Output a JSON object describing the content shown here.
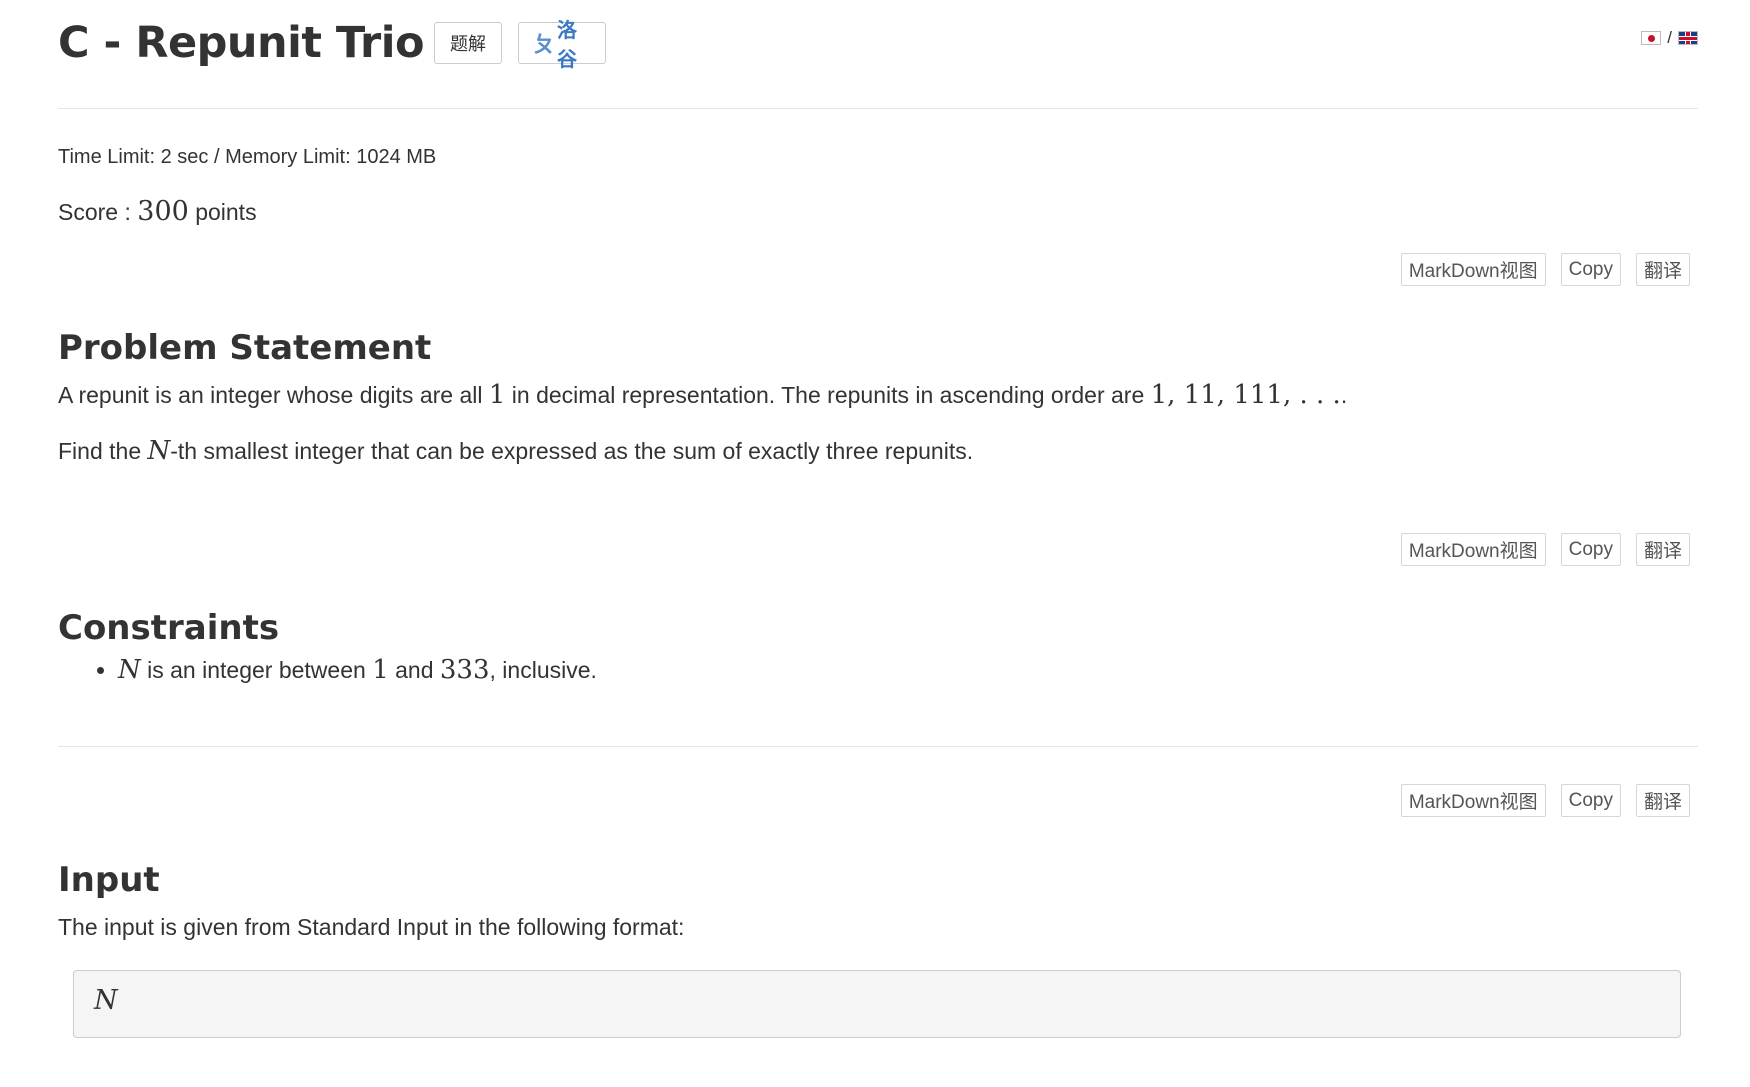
{
  "header": {
    "title": "C - Repunit Trio",
    "editorial_label": "题解",
    "luogu_label": "洛谷",
    "luogu_glyph": "ㄆ",
    "lang_separator": "/"
  },
  "limits": {
    "text": "Time Limit: 2 sec / Memory Limit: 1024 MB"
  },
  "score": {
    "prefix": "Score : ",
    "value": "300",
    "suffix": " points"
  },
  "toolbar": {
    "markdown_label": "MarkDown视图",
    "copy_label": "Copy",
    "translate_label": "翻译"
  },
  "problem": {
    "heading": "Problem Statement",
    "p1_a": "A repunit is an integer whose digits are all ",
    "p1_math1": "1",
    "p1_b": " in decimal representation. The repunits in ascending order are ",
    "p1_math2": "1, 11, 111, . . .",
    "p1_c": ".",
    "p2_a": "Find the ",
    "p2_math": "N",
    "p2_b": "-th smallest integer that can be expressed as the sum of exactly three repunits."
  },
  "constraints": {
    "heading": "Constraints",
    "item_math_n": "N",
    "item_a": " is an integer between ",
    "item_math_1": "1",
    "item_b": " and ",
    "item_math_333": "333",
    "item_c": ", inclusive."
  },
  "input": {
    "heading": "Input",
    "text": "The input is given from Standard Input in the following format:",
    "format_var": "N"
  },
  "colors": {
    "text": "#333333",
    "luogu_blue": "#3a78c3",
    "pre_bg": "#f5f5f5",
    "divider": "#e6e6e6"
  }
}
